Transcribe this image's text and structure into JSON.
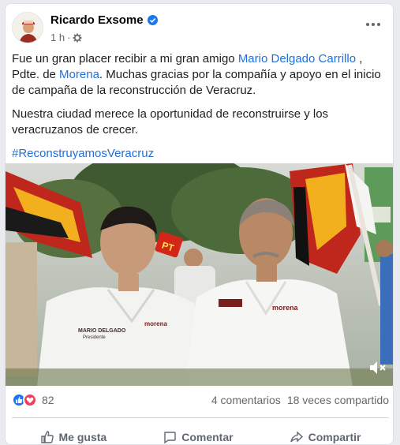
{
  "post": {
    "author": "Ricardo Exsome",
    "time": "1 h",
    "time_separator": "·",
    "text_part1": "Fue un gran placer recibir a mi gran amigo ",
    "mention1": "Mario Delgado Carrillo",
    "text_part2": " , Pdte. de ",
    "mention2": "Morena",
    "text_part3": ". Muchas gracias por la compañía y apoyo en el inicio de campaña de la reconstrucción de Veracruz.",
    "paragraph2": "Nuestra ciudad merece la oportunidad de reconstruirse y los veracruzanos de crecer.",
    "hashtag": "#ReconstruyamosVeracruz"
  },
  "video": {
    "badge_pt": "PT",
    "shirt1_name": "MARIO DELGADO",
    "shirt1_title": "Presidente",
    "shirt1_logo": "morena",
    "shirt2_logo": "morena"
  },
  "stats": {
    "reactions": "82",
    "comments": "4 comentarios",
    "shares": "18 veces compartido"
  },
  "actions": {
    "like": "Me gusta",
    "comment": "Comentar",
    "share": "Compartir"
  },
  "colors": {
    "link": "#216fdb",
    "like": "#1877f2",
    "love": "#f33e58"
  }
}
